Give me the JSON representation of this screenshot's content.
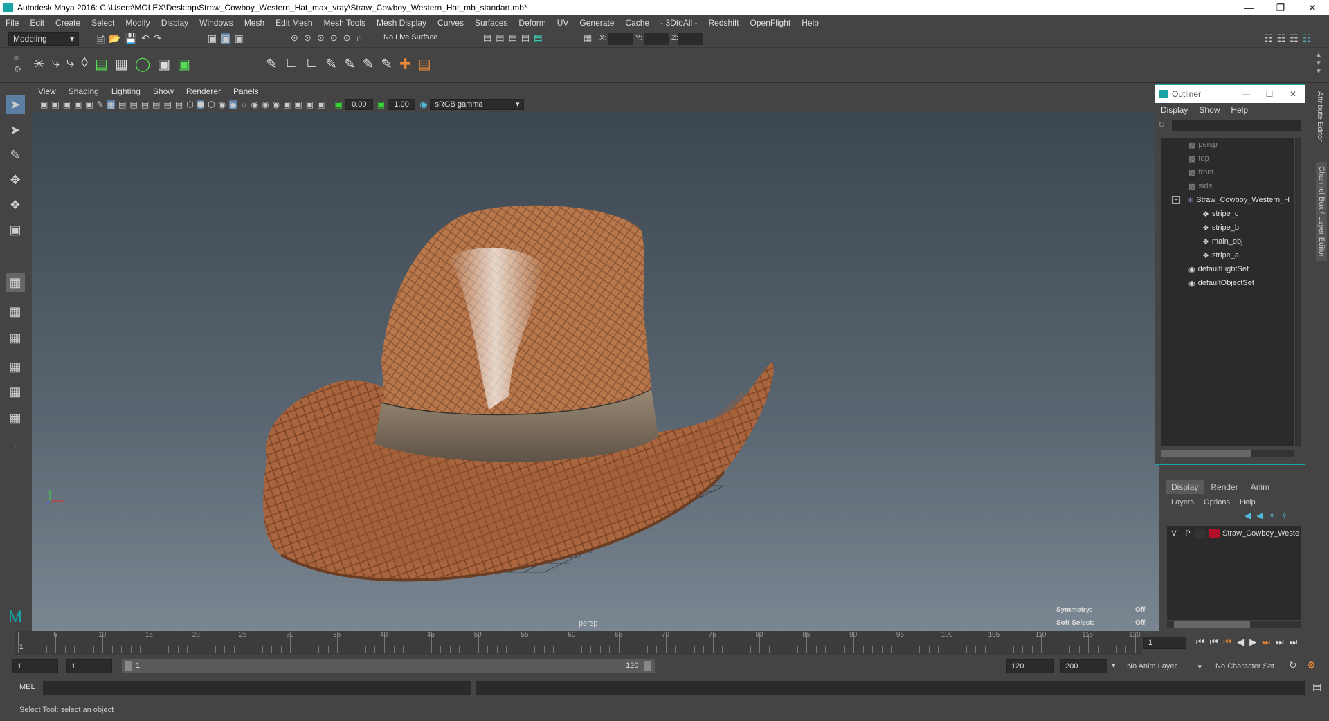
{
  "window": {
    "title": "Autodesk Maya 2016: C:\\Users\\MOLEX\\Desktop\\Straw_Cowboy_Western_Hat_max_vray\\Straw_Cowboy_Western_Hat_mb_standart.mb*"
  },
  "menus": [
    "File",
    "Edit",
    "Create",
    "Select",
    "Modify",
    "Display",
    "Windows",
    "Mesh",
    "Edit Mesh",
    "Mesh Tools",
    "Mesh Display",
    "Curves",
    "Surfaces",
    "Deform",
    "UV",
    "Generate",
    "Cache",
    "- 3DtoAll -",
    "Redshift",
    "OpenFlight",
    "Help"
  ],
  "status": {
    "mode": "Modeling",
    "live_surface": "No Live Surface",
    "x_label": "X:",
    "y_label": "Y:",
    "z_label": "Z:"
  },
  "viewport": {
    "menus": [
      "View",
      "Shading",
      "Lighting",
      "Show",
      "Renderer",
      "Panels"
    ],
    "exposure": "0.00",
    "gamma": "1.00",
    "color_space": "sRGB gamma",
    "camera_label": "persp",
    "symmetry_label": "Symmetry:",
    "symmetry_value": "Off",
    "soft_select_label": "Soft Select:",
    "soft_select_value": "Off"
  },
  "outliner": {
    "title": "Outliner",
    "menus": [
      "Display",
      "Show",
      "Help"
    ],
    "items": [
      "persp",
      "top",
      "front",
      "side",
      "Straw_Cowboy_Western_H",
      "stripe_c",
      "stripe_b",
      "main_obj",
      "stripe_a",
      "defaultLightSet",
      "defaultObjectSet"
    ]
  },
  "layer_editor": {
    "tabs": [
      "Display",
      "Render",
      "Anim"
    ],
    "menus": [
      "Layers",
      "Options",
      "Help"
    ],
    "layer": {
      "v": "V",
      "p": "P",
      "name": "Straw_Cowboy_Weste",
      "color": "#b0102a"
    }
  },
  "side_tabs": [
    "Attribute Editor",
    "Channel Box / Layer Editor"
  ],
  "timeline": {
    "ticks": [
      "5",
      "10",
      "15",
      "20",
      "25",
      "30",
      "35",
      "40",
      "45",
      "50",
      "55",
      "60",
      "65",
      "70",
      "75",
      "80",
      "85",
      "90",
      "95",
      "100",
      "105",
      "110",
      "115",
      "120"
    ],
    "start_label": "1",
    "current_frame": "1"
  },
  "range": {
    "start": "1",
    "playback_start": "1",
    "slider_start": "1",
    "slider_end": "120",
    "playback_end": "120",
    "end": "200",
    "anim_layer": "No Anim Layer",
    "character_set": "No Character Set"
  },
  "command": {
    "label": "MEL"
  },
  "help_line": "Select Tool: select an object"
}
